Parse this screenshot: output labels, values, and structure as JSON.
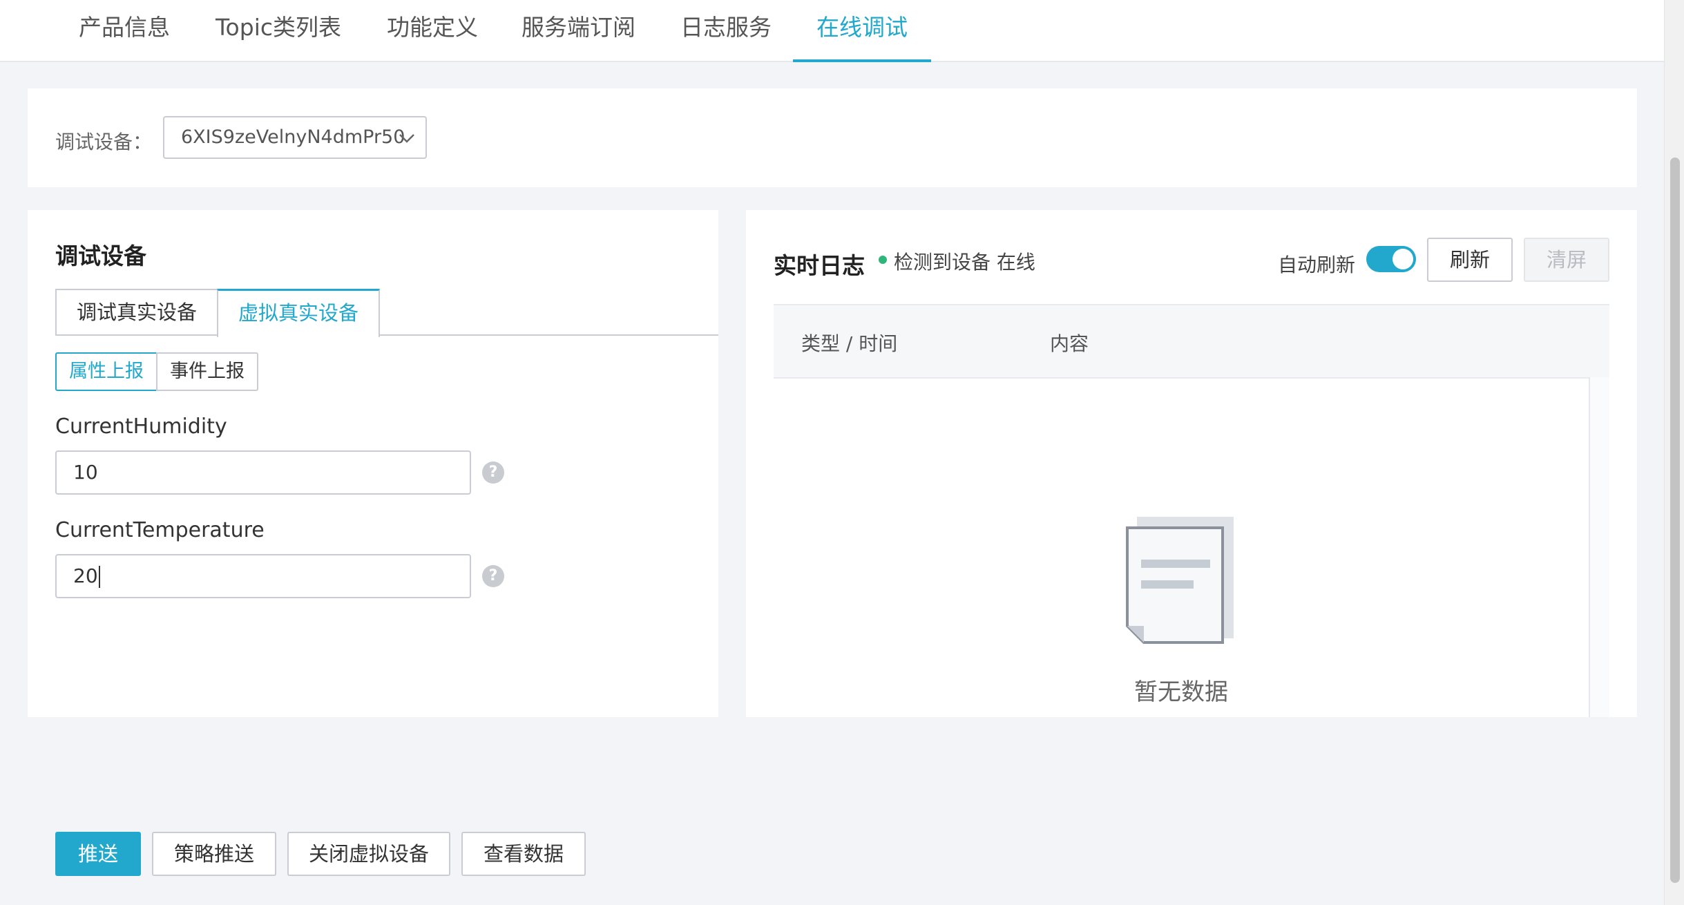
{
  "tabs": [
    {
      "label": "产品信息",
      "active": false
    },
    {
      "label": "Topic类列表",
      "active": false
    },
    {
      "label": "功能定义",
      "active": false
    },
    {
      "label": "服务端订阅",
      "active": false
    },
    {
      "label": "日志服务",
      "active": false
    },
    {
      "label": "在线调试",
      "active": true
    }
  ],
  "device_selector": {
    "label": "调试设备：",
    "value": "6XIS9zeVelnyN4dmPr50"
  },
  "debug_panel": {
    "title": "调试设备",
    "mode_tabs": [
      "调试真实设备",
      "虚拟真实设备"
    ],
    "active_mode": "虚拟真实设备",
    "report_tabs": [
      "属性上报",
      "事件上报"
    ],
    "active_report": "属性上报",
    "fields": [
      {
        "name": "CurrentHumidity",
        "value": "10"
      },
      {
        "name": "CurrentTemperature",
        "value": "20"
      }
    ],
    "actions": {
      "push": "推送",
      "strategy_push": "策略推送",
      "close_virtual": "关闭虚拟设备",
      "view_data": "查看数据"
    }
  },
  "log_panel": {
    "title": "实时日志",
    "status_text": "检测到设备 在线",
    "auto_refresh_label": "自动刷新",
    "auto_refresh_on": true,
    "refresh_label": "刷新",
    "clear_label": "清屏",
    "columns": [
      "类型 / 时间",
      "内容"
    ],
    "empty_text": "暂无数据"
  },
  "colors": {
    "accent": "#21a8cc",
    "online": "#2fb67a"
  }
}
